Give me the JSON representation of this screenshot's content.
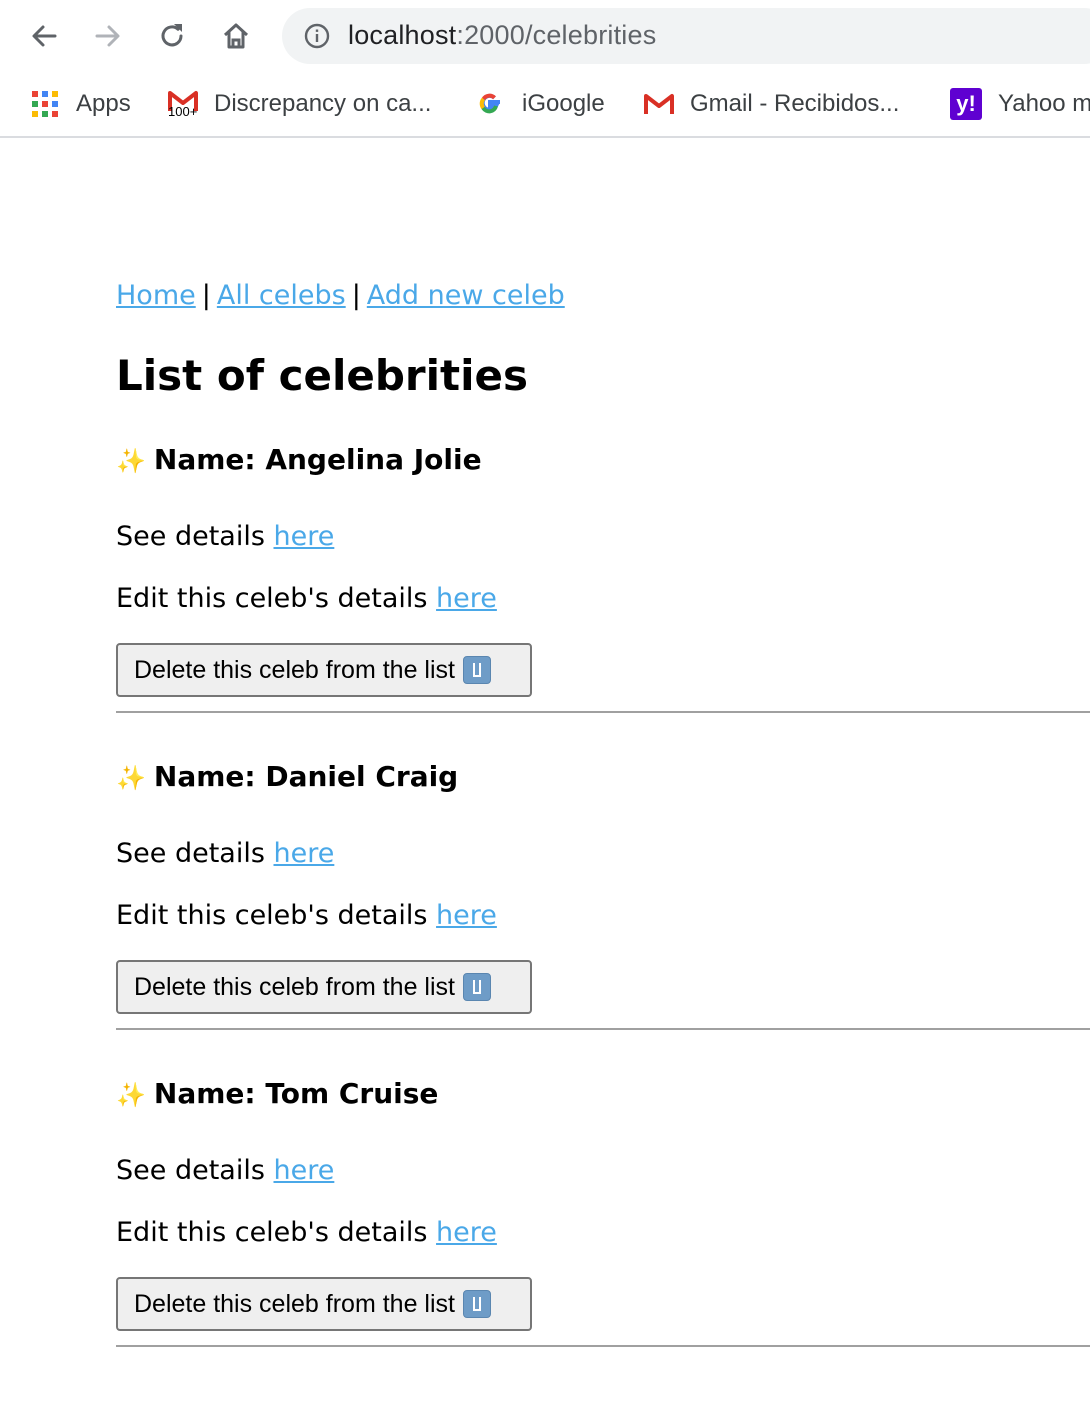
{
  "browser": {
    "url_host": "localhost",
    "url_path": ":2000/celebrities",
    "bookmarks": [
      {
        "label": "Apps",
        "icon": "apps-grid-icon"
      },
      {
        "label": "Discrepancy on ca...",
        "icon": "gmail-icon",
        "badge": "100+"
      },
      {
        "label": "iGoogle",
        "icon": "google-icon"
      },
      {
        "label": "Gmail - Recibidos...",
        "icon": "gmail-icon"
      },
      {
        "label": "Yahoo m",
        "icon": "yahoo-icon"
      }
    ]
  },
  "nav": {
    "home": "Home",
    "sep1": "|",
    "all": "All celebs",
    "sep2": "|",
    "add": "Add new celeb"
  },
  "page_title": "List of celebrities",
  "celebs": [
    {
      "sparkle": "✨",
      "name": "Name: Angelina Jolie",
      "details_text": "See details ",
      "details_link": "here",
      "edit_text": "Edit this celeb's details ",
      "edit_link": "here",
      "delete_label": "Delete this celeb from the list"
    },
    {
      "sparkle": "✨",
      "name": "Name: Daniel Craig",
      "details_text": "See details ",
      "details_link": "here",
      "edit_text": "Edit this celeb's details ",
      "edit_link": "here",
      "delete_label": "Delete this celeb from the list"
    },
    {
      "sparkle": "✨",
      "name": "Name: Tom Cruise",
      "details_text": "See details ",
      "details_link": "here",
      "edit_text": "Edit this celeb's details ",
      "edit_link": "here",
      "delete_label": "Delete this celeb from the list"
    }
  ],
  "colors": {
    "link": "#4aa8e8",
    "omnibox_bg": "#f1f3f4",
    "button_bg": "#efefef",
    "yahoo": "#5f01d1"
  }
}
